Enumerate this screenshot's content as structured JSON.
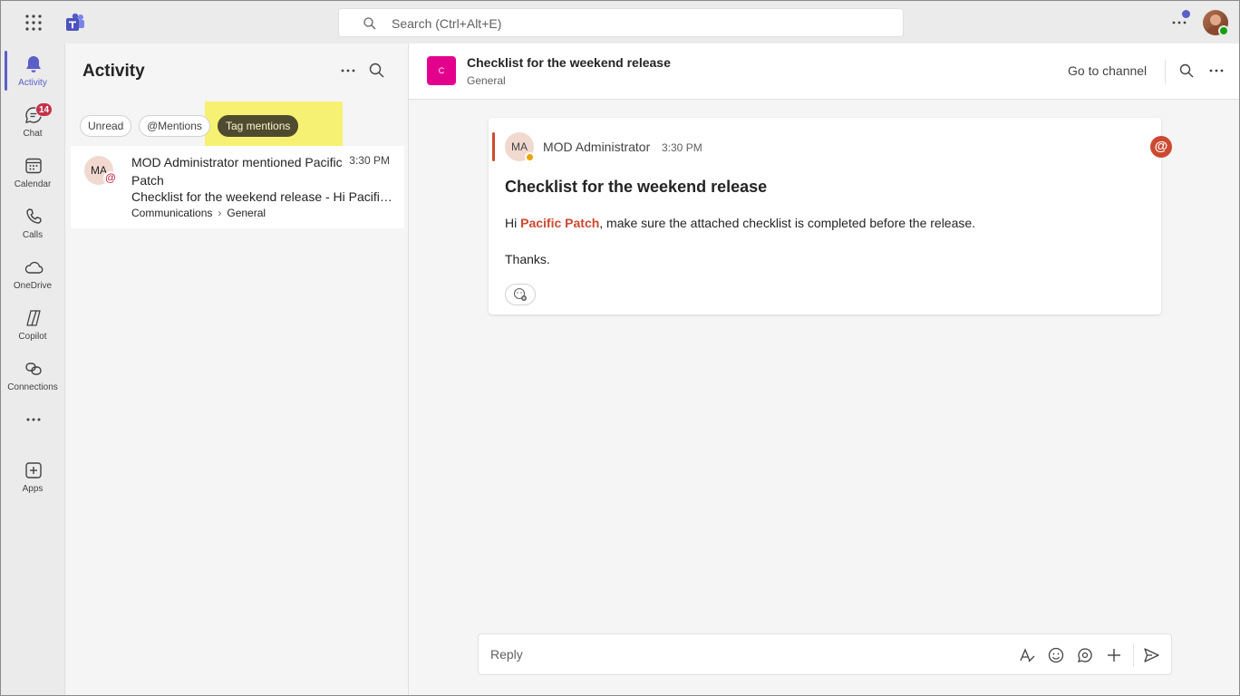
{
  "search": {
    "placeholder": "Search (Ctrl+Alt+E)"
  },
  "rail": {
    "items": [
      {
        "label": "Activity",
        "icon": "bell-icon"
      },
      {
        "label": "Chat",
        "icon": "chat-icon",
        "badge": "14"
      },
      {
        "label": "Calendar",
        "icon": "calendar-icon"
      },
      {
        "label": "Calls",
        "icon": "phone-icon"
      },
      {
        "label": "OneDrive",
        "icon": "cloud-icon"
      },
      {
        "label": "Copilot",
        "icon": "copilot-icon"
      },
      {
        "label": "Connections",
        "icon": "connections-icon"
      },
      {
        "label": "",
        "icon": "more-icon"
      },
      {
        "label": "Apps",
        "icon": "add-app-icon"
      }
    ]
  },
  "activity": {
    "title": "Activity",
    "filters": [
      "Unread",
      "@Mentions",
      "Tag mentions"
    ],
    "item": {
      "avatar": "MA",
      "title": "MOD Administrator mentioned Pacific Patch",
      "time": "3:30 PM",
      "preview": "Checklist for the weekend release - Hi Pacific Patch, make sure the attached checklist is completed before the release.",
      "team": "Communications",
      "channel": "General"
    }
  },
  "channel": {
    "avatar": "C",
    "title": "Checklist for the weekend release",
    "subtitle": "General",
    "goto": "Go to channel"
  },
  "message": {
    "avatar": "MA",
    "author": "MOD Administrator",
    "time": "3:30 PM",
    "subject": "Checklist for the weekend release",
    "greeting": "Hi ",
    "mention": "Pacific Patch",
    "body_rest": ", make sure the attached checklist is completed before the release.",
    "thanks": "Thanks."
  },
  "reply": {
    "placeholder": "Reply"
  },
  "colors": {
    "accent": "#5b5fc7",
    "mention": "#cc4a31",
    "channel_avatar": "#e3008c",
    "highlight": "#f6f05a"
  }
}
